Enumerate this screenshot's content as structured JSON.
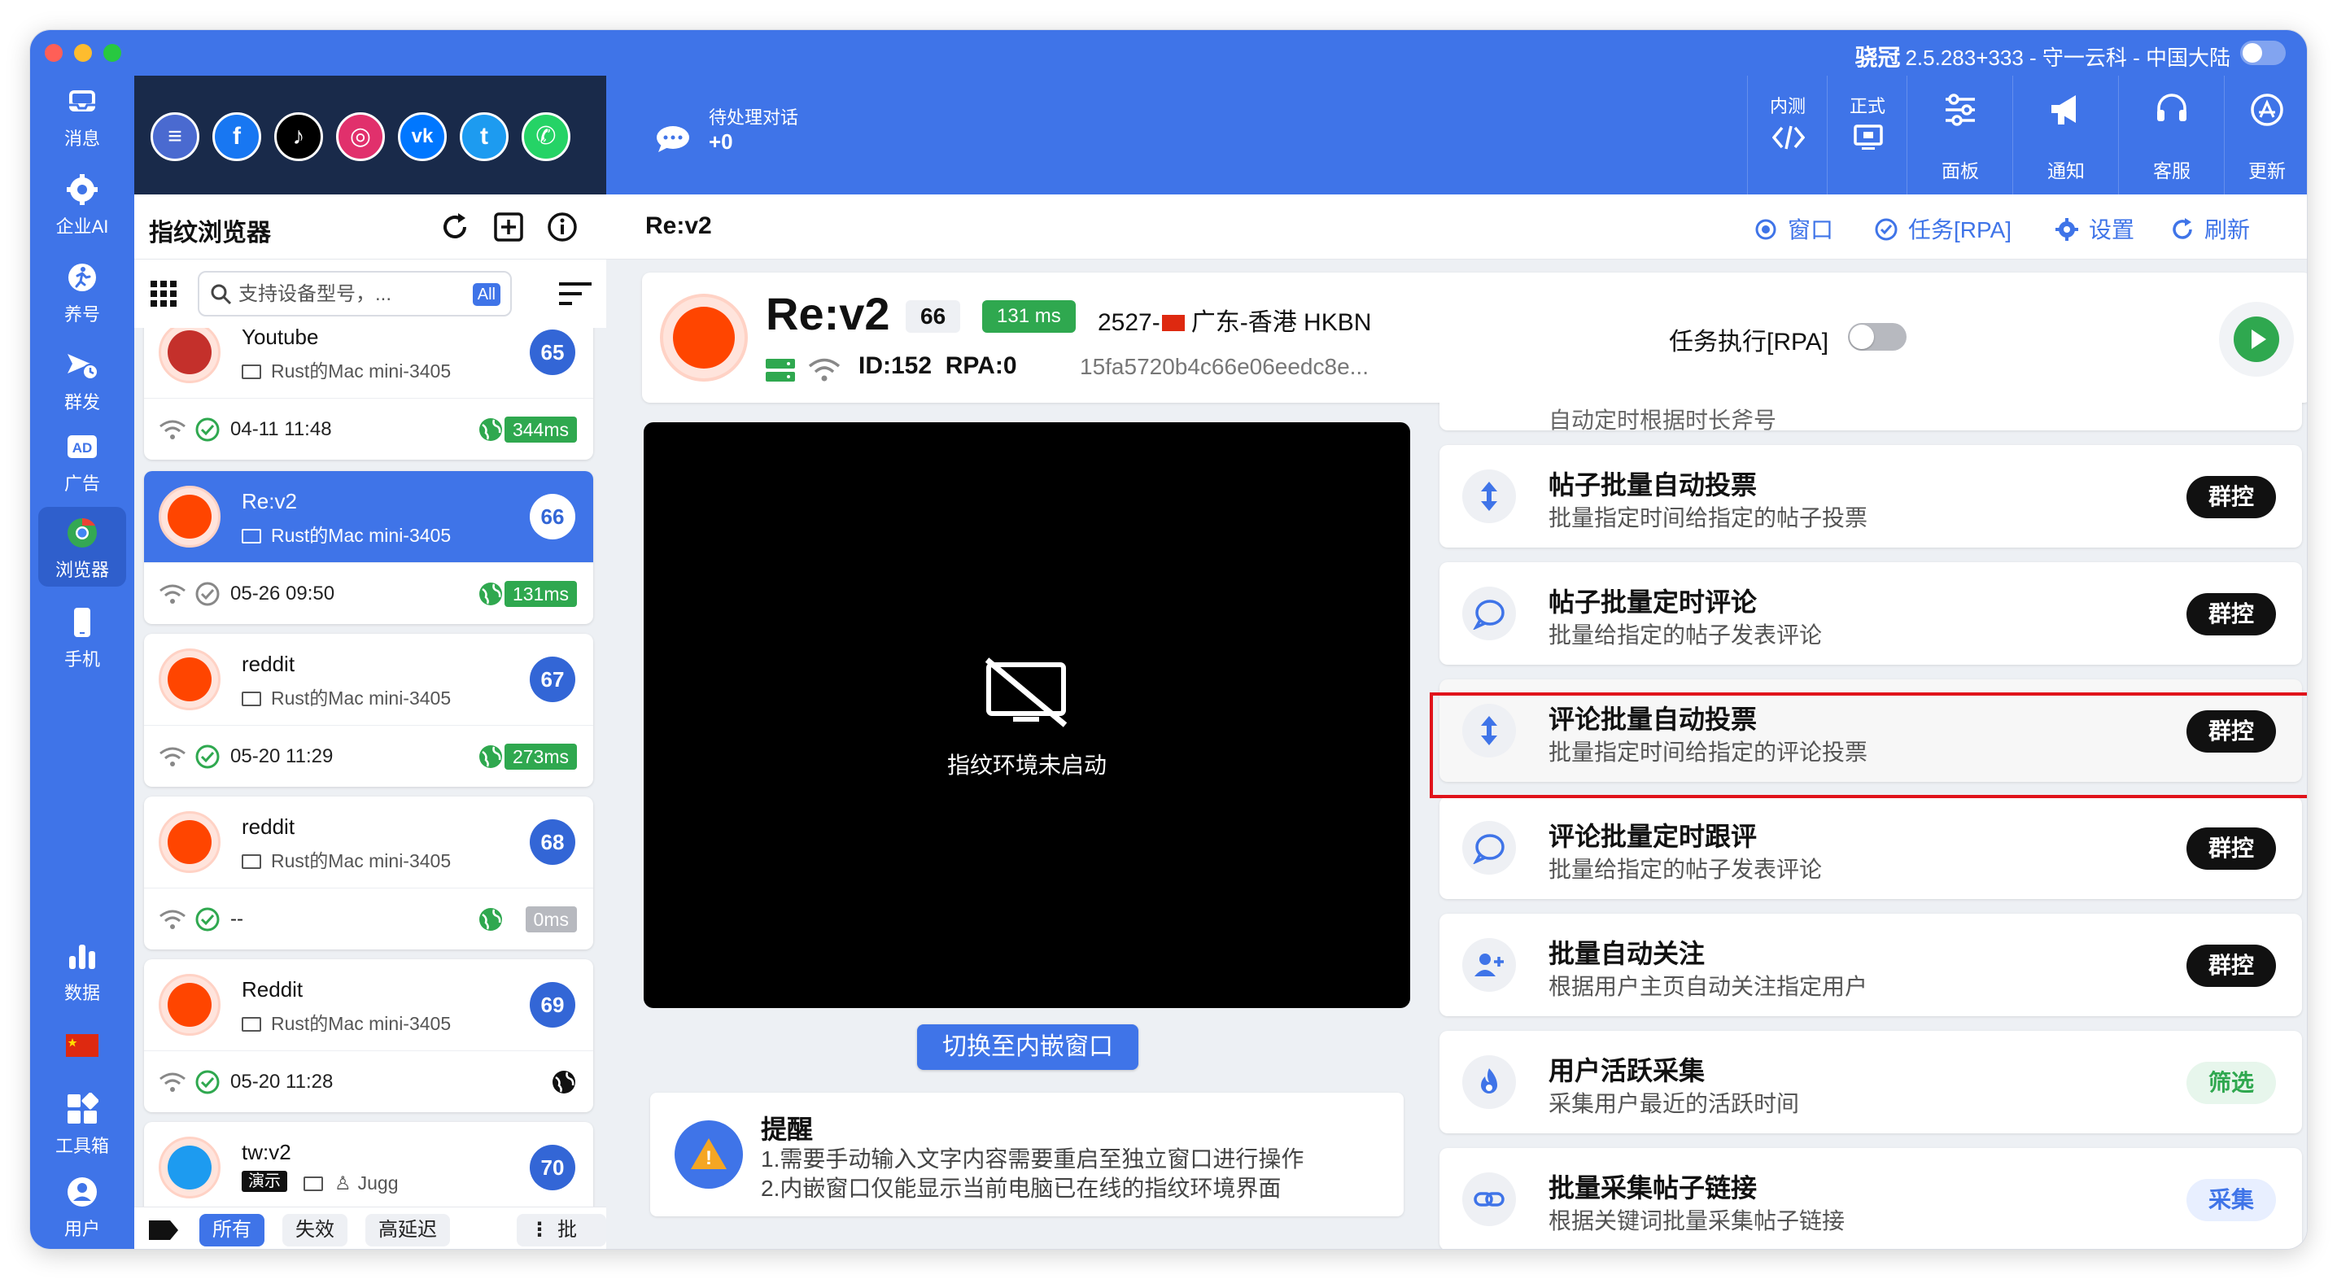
{
  "titlebar": {
    "brand": "骁冠",
    "version_info": "2.5.283+333 - 守一云科 - 中国大陆"
  },
  "nav": [
    {
      "icon": "inbox-icon",
      "label": "消息"
    },
    {
      "icon": "gear-chat-icon",
      "label": "企业AI"
    },
    {
      "icon": "person-run-icon",
      "label": "养号"
    },
    {
      "icon": "send-clock-icon",
      "label": "群发"
    },
    {
      "icon": "ad-icon",
      "label": "广告"
    },
    {
      "icon": "chrome-icon",
      "label": "浏览器"
    },
    {
      "icon": "phone-icon",
      "label": "手机"
    },
    {
      "icon": "bar-chart-icon",
      "label": "数据"
    },
    {
      "icon": "china-flag-icon",
      "label": ""
    },
    {
      "icon": "toolbox-icon",
      "label": "工具箱"
    },
    {
      "icon": "user-icon",
      "label": "用户"
    }
  ],
  "social": [
    "stack-icon",
    "facebook-icon",
    "tiktok-icon",
    "instagram-icon",
    "vk-icon",
    "twitter-icon",
    "whatsapp-icon"
  ],
  "list": {
    "title": "指纹浏览器",
    "search_placeholder": "支持设备型号，...",
    "search_badge": "All",
    "items": [
      {
        "name": "Youtube",
        "device": "Rust的Mac mini-3405",
        "number": "65",
        "time": "04-11 11:48",
        "latency": "344ms",
        "logo": "youtube"
      },
      {
        "name": "Re:v2",
        "device": "Rust的Mac mini-3405",
        "number": "66",
        "time": "05-26 09:50",
        "latency": "131ms",
        "logo": "reddit"
      },
      {
        "name": "reddit",
        "device": "Rust的Mac mini-3405",
        "number": "67",
        "time": "05-20 11:29",
        "latency": "273ms",
        "logo": "reddit"
      },
      {
        "name": "reddit",
        "device": "Rust的Mac mini-3405",
        "number": "68",
        "time": "--",
        "latency": "0ms",
        "logo": "reddit"
      },
      {
        "name": "Reddit",
        "device": "Rust的Mac mini-3405",
        "number": "69",
        "time": "05-20 11:28",
        "latency": "",
        "logo": "reddit"
      },
      {
        "name": "tw:v2",
        "device": "",
        "number": "70",
        "time": "",
        "latency": "",
        "logo": "twitter",
        "demo": "演示",
        "owner": "Jugg"
      }
    ],
    "filters": {
      "all": "所有",
      "invalid": "失效",
      "high_latency": "高延迟",
      "batch": "批量"
    }
  },
  "topbar": {
    "pending_label": "待处理对话",
    "pending_count": "+0",
    "buttons": {
      "internal": "内测",
      "official": "正式",
      "panel": "面板",
      "notice": "通知",
      "service": "客服",
      "update": "更新"
    }
  },
  "subbar": {
    "title": "Re:v2",
    "window": "窗口",
    "task": "任务[RPA]",
    "settings": "设置",
    "refresh": "刷新"
  },
  "profile": {
    "name": "Re:v2",
    "number": "66",
    "latency": "131 ms",
    "loc_prefix": "2527-",
    "location": "广东-香港 HKBN",
    "id": "ID:152",
    "rpa": "RPA:0",
    "hash": "15fa5720b4c66e06eedc8e...",
    "rpa_toggle_label": "任务执行[RPA]"
  },
  "screen": {
    "message": "指纹环境未启动",
    "switch_button": "切换至内嵌窗口"
  },
  "reminder": {
    "title": "提醒",
    "line1": "1.需要手动输入文字内容需要重启至独立窗口进行操作",
    "line2": "2.内嵌窗口仅能显示当前电脑已在线的指纹环境界面"
  },
  "tasks": [
    {
      "title": "自动定时根据时长斧号",
      "desc": "",
      "button": ""
    },
    {
      "title": "帖子批量自动投票",
      "desc": "批量指定时间给指定的帖子投票",
      "button": "群控"
    },
    {
      "title": "帖子批量定时评论",
      "desc": "批量给指定的帖子发表评论",
      "button": "群控"
    },
    {
      "title": "评论批量自动投票",
      "desc": "批量指定时间给指定的评论投票",
      "button": "群控"
    },
    {
      "title": "评论批量定时跟评",
      "desc": "批量给指定的帖子发表评论",
      "button": "群控"
    },
    {
      "title": "批量自动关注",
      "desc": "根据用户主页自动关注指定用户",
      "button": "群控"
    },
    {
      "title": "用户活跃采集",
      "desc": "采集用户最近的活跃时间",
      "button": "筛选"
    },
    {
      "title": "批量采集帖子链接",
      "desc": "根据关键词批量采集帖子链接",
      "button": "采集"
    }
  ],
  "colors": {
    "accent": "#3f74e8",
    "dark_header": "#192a4a",
    "success": "#2fa84f",
    "reddit": "#ff4500",
    "highlight": "#e0131b"
  }
}
